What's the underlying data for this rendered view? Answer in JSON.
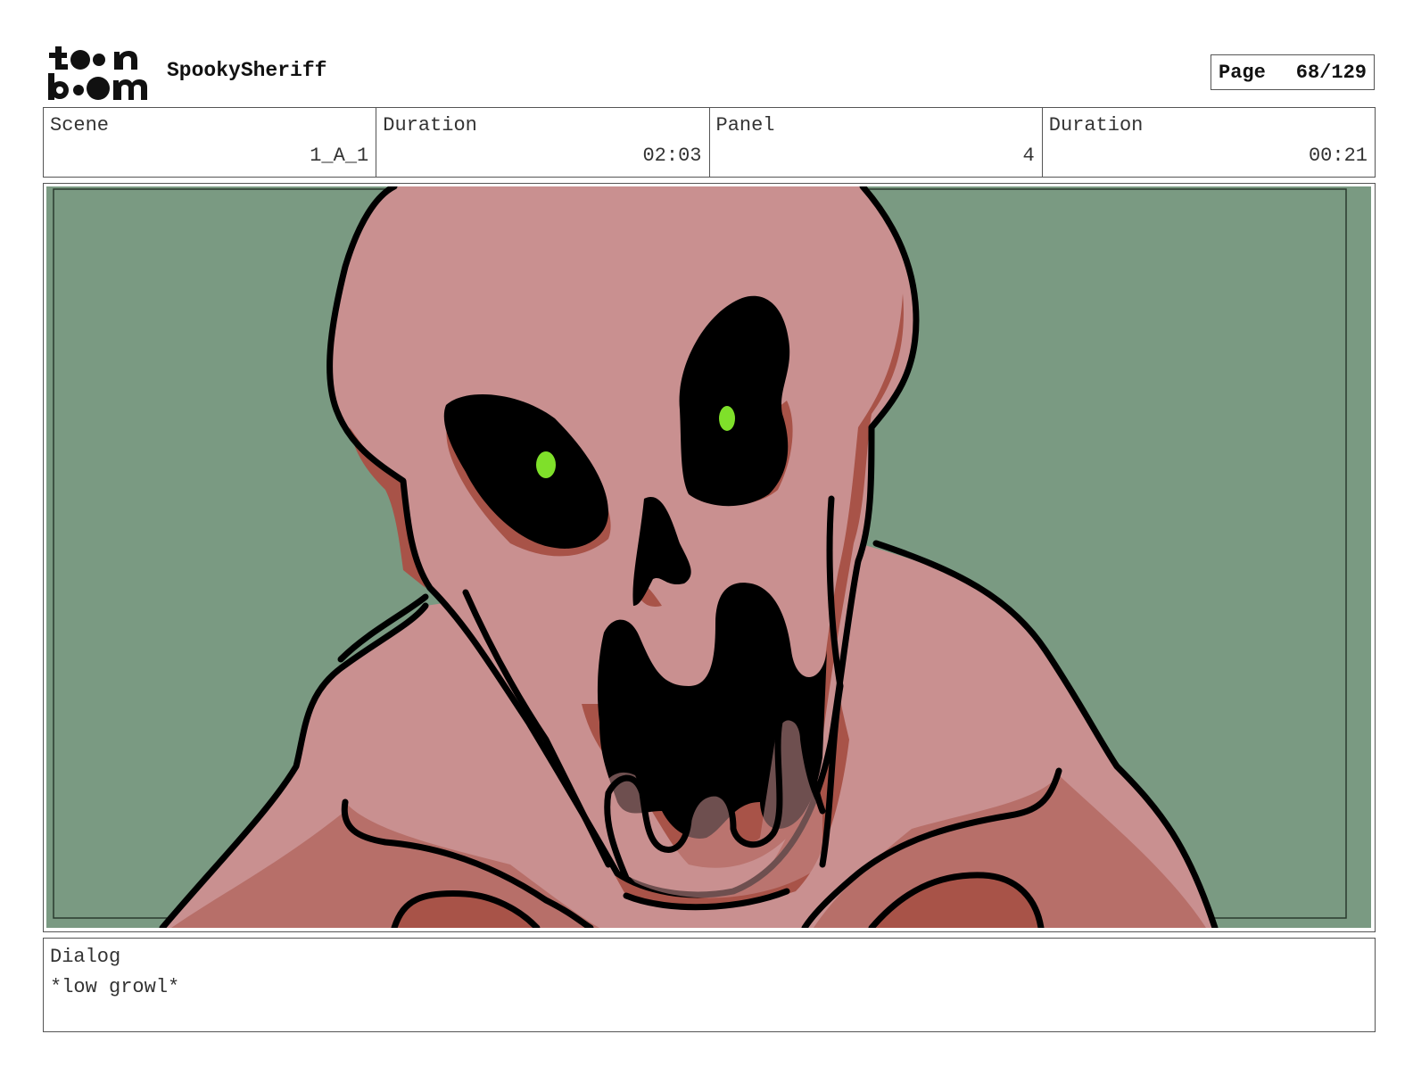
{
  "header": {
    "logo_text": "toon boom",
    "project_title": "SpookySheriff",
    "page_label": "Page",
    "page_value": "68/129"
  },
  "info": {
    "scene_label": "Scene",
    "scene_value": "1_A_1",
    "scene_duration_label": "Duration",
    "scene_duration_value": "02:03",
    "panel_label": "Panel",
    "panel_value": "4",
    "panel_duration_label": "Duration",
    "panel_duration_value": "00:21"
  },
  "panel_image": {
    "subject": "monster-skull-face",
    "colors": {
      "background": "#7a9a82",
      "skin": "#c99090",
      "shadow": "#a85348",
      "outline": "#000000",
      "eye_glow": "#7fe02a"
    }
  },
  "dialog": {
    "label": "Dialog",
    "text": "*low growl*"
  }
}
